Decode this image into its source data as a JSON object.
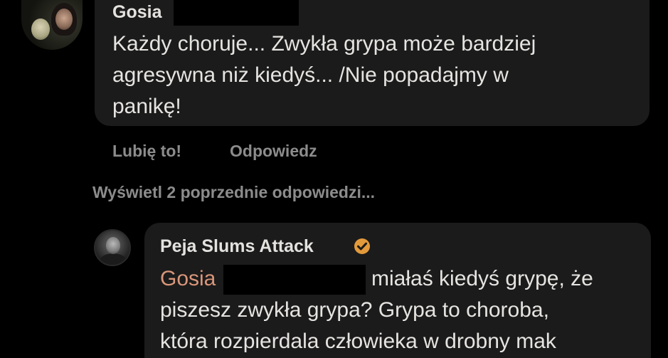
{
  "colors": {
    "background": "#000000",
    "bubble": "#1b1b1b",
    "text": "#e6e4e1",
    "muted": "#8c8c8c",
    "mention": "#d9967a",
    "verified_badge": "#e39a3b"
  },
  "gosia_comment": {
    "author": "Gosia",
    "lines": [
      "Każdy choruje... Zwykła grypa może bardziej",
      "agresywna niż kiedyś... /Nie popadajmy w",
      "panikę!"
    ],
    "actions": {
      "like": "Lubię to!",
      "reply": "Odpowiedz"
    }
  },
  "view_previous_replies": "Wyświetl 2 poprzednie odpowiedzi...",
  "peja_reply": {
    "author": "Peja Slums Attack",
    "badge_icon": "verified-badge-icon",
    "mention": "Gosia",
    "line1_rest": "miałaś kiedyś grypę, że",
    "lines": [
      "piszesz zwykła grypa? Grypa to choroba,",
      "która rozpierdala człowieka w drobny mak"
    ]
  }
}
